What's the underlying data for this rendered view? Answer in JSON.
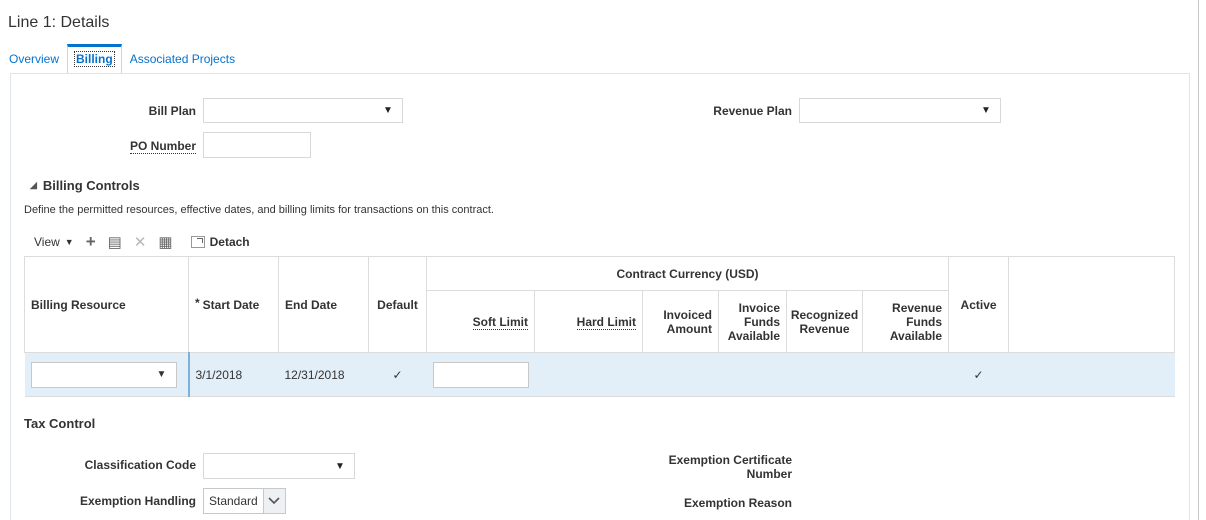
{
  "page": {
    "title": "Line 1: Details"
  },
  "tabs": [
    {
      "label": "Overview"
    },
    {
      "label": "Billing"
    },
    {
      "label": "Associated Projects"
    }
  ],
  "billing": {
    "bill_plan_label": "Bill Plan",
    "bill_plan_value": "",
    "revenue_plan_label": "Revenue Plan",
    "revenue_plan_value": "",
    "po_number_label": "PO Number",
    "po_number_value": ""
  },
  "billing_controls": {
    "heading": "Billing Controls",
    "description": "Define the permitted resources, effective dates, and billing limits for transactions on this contract.",
    "toolbar": {
      "view_label": "View",
      "detach_label": "Detach"
    },
    "columns": {
      "billing_resource": "Billing Resource",
      "start_date": "Start Date",
      "end_date": "End Date",
      "default": "Default",
      "currency_group": "Contract Currency (USD)",
      "soft_limit": "Soft Limit",
      "hard_limit": "Hard Limit",
      "invoiced_amount": "Invoiced Amount",
      "invoice_funds_available": "Invoice Funds Available",
      "recognized_revenue": "Recognized Revenue",
      "revenue_funds_available": "Revenue Funds Available",
      "active": "Active"
    },
    "rows": [
      {
        "billing_resource": "",
        "start_date": "3/1/2018",
        "end_date": "12/31/2018",
        "default": "✓",
        "soft_limit": "",
        "active": "✓"
      }
    ]
  },
  "tax_control": {
    "heading": "Tax Control",
    "classification_code_label": "Classification Code",
    "classification_code_value": "",
    "exemption_handling_label": "Exemption Handling",
    "exemption_handling_value": "Standard",
    "exemption_certificate_label_1": "Exemption Certificate",
    "exemption_certificate_label_2": "Number",
    "exemption_reason_label": "Exemption Reason"
  },
  "icons": {
    "dropdown": "triangle-down-icon",
    "add": "plus-icon",
    "edit": "edit-icon",
    "delete": "x-icon",
    "freeze": "freeze-columns-icon",
    "detach": "detach-icon",
    "chevron": "chevron-down-icon",
    "collapse": "collapse-triangle-icon"
  },
  "colors": {
    "accent": "#0572ce",
    "selected_row": "#e2eef8"
  }
}
